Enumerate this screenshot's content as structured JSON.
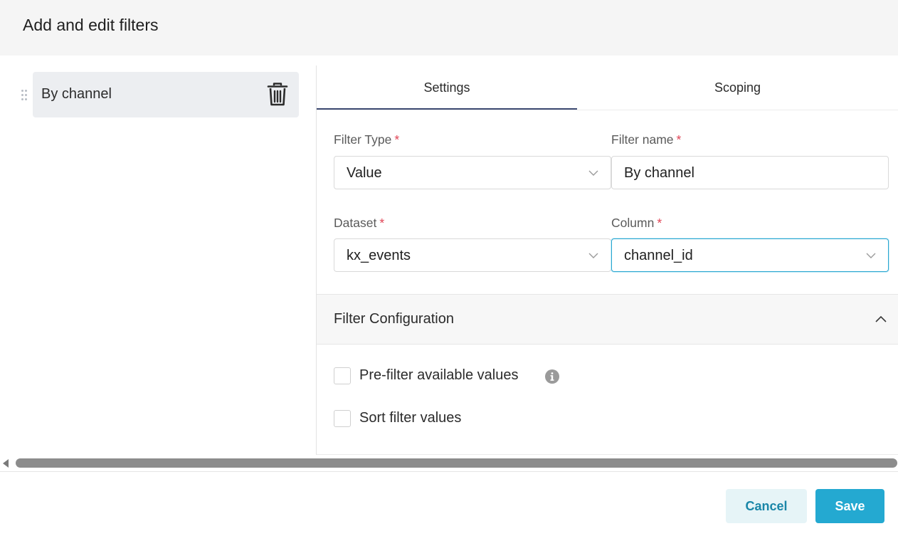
{
  "header": {
    "title": "Add and edit filters"
  },
  "filter_list": {
    "items": [
      {
        "label": "By channel"
      }
    ]
  },
  "tabs": [
    {
      "label": "Settings"
    },
    {
      "label": "Scoping"
    }
  ],
  "form": {
    "filter_type": {
      "label": "Filter Type",
      "required": "*",
      "value": "Value"
    },
    "filter_name": {
      "label": "Filter name",
      "required": "*",
      "value": "By channel"
    },
    "dataset": {
      "label": "Dataset",
      "required": "*",
      "value": "kx_events"
    },
    "column": {
      "label": "Column",
      "required": "*",
      "value": "channel_id"
    }
  },
  "section": {
    "title": "Filter Configuration",
    "options": [
      {
        "label": "Pre-filter available values",
        "checked": false
      },
      {
        "label": "Sort filter values",
        "checked": false
      }
    ]
  },
  "footer": {
    "cancel_label": "Cancel",
    "save_label": "Save"
  },
  "colors": {
    "accent": "#24a9d1",
    "required": "#e04355",
    "tab_underline": "#3d4a72"
  }
}
